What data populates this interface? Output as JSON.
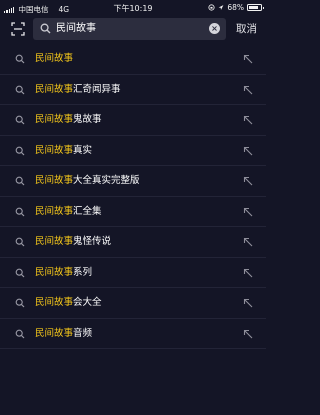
{
  "status_bar": {
    "carrier": "中国电信",
    "network": "4G",
    "time": "下午10:19",
    "battery": "68%"
  },
  "search": {
    "query": "民间故事",
    "cancel_label": "取消"
  },
  "suggestions": [
    {
      "highlight": "民间故事",
      "rest": ""
    },
    {
      "highlight": "民间故事",
      "rest": "汇奇闻异事"
    },
    {
      "highlight": "民间故事",
      "rest": "鬼故事"
    },
    {
      "highlight": "民间故事",
      "rest": "真实"
    },
    {
      "highlight": "民间故事",
      "rest": "大全真实完整版"
    },
    {
      "highlight": "民间故事",
      "rest": "汇全集"
    },
    {
      "highlight": "民间故事",
      "rest": "鬼怪传说"
    },
    {
      "highlight": "民间故事",
      "rest": "系列"
    },
    {
      "highlight": "民间故事",
      "rest": "会大全"
    },
    {
      "highlight": "民间故事",
      "rest": "音频"
    }
  ],
  "colors": {
    "background": "#141526",
    "highlight": "#f5c71a",
    "search_box": "#2c2d3e"
  },
  "icons": {
    "scan": "scan-icon",
    "search": "search-icon",
    "clear": "clear-icon",
    "suggestion": "search-icon",
    "fill": "arrow-up-left-icon"
  }
}
